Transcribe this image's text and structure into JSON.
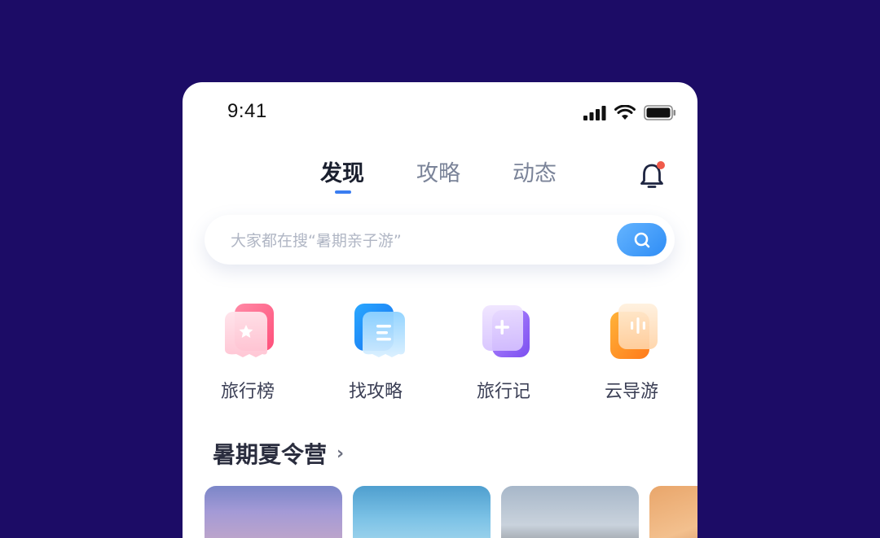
{
  "status_bar": {
    "time": "9:41"
  },
  "tabs": [
    {
      "label": "发现",
      "active": true
    },
    {
      "label": "攻略",
      "active": false
    },
    {
      "label": "动态",
      "active": false
    }
  ],
  "search": {
    "placeholder": "大家都在搜“暑期亲子游”"
  },
  "quick_links": [
    {
      "label": "旅行榜",
      "icon": "star-icon"
    },
    {
      "label": "找攻略",
      "icon": "list-icon"
    },
    {
      "label": "旅行记",
      "icon": "plus-icon"
    },
    {
      "label": "云导游",
      "icon": "audio-icon"
    }
  ],
  "section": {
    "title": "暑期夏令营"
  },
  "colors": {
    "background": "#1c0c66",
    "accent": "#3a7df1",
    "notification_dot": "#f05a4a"
  }
}
